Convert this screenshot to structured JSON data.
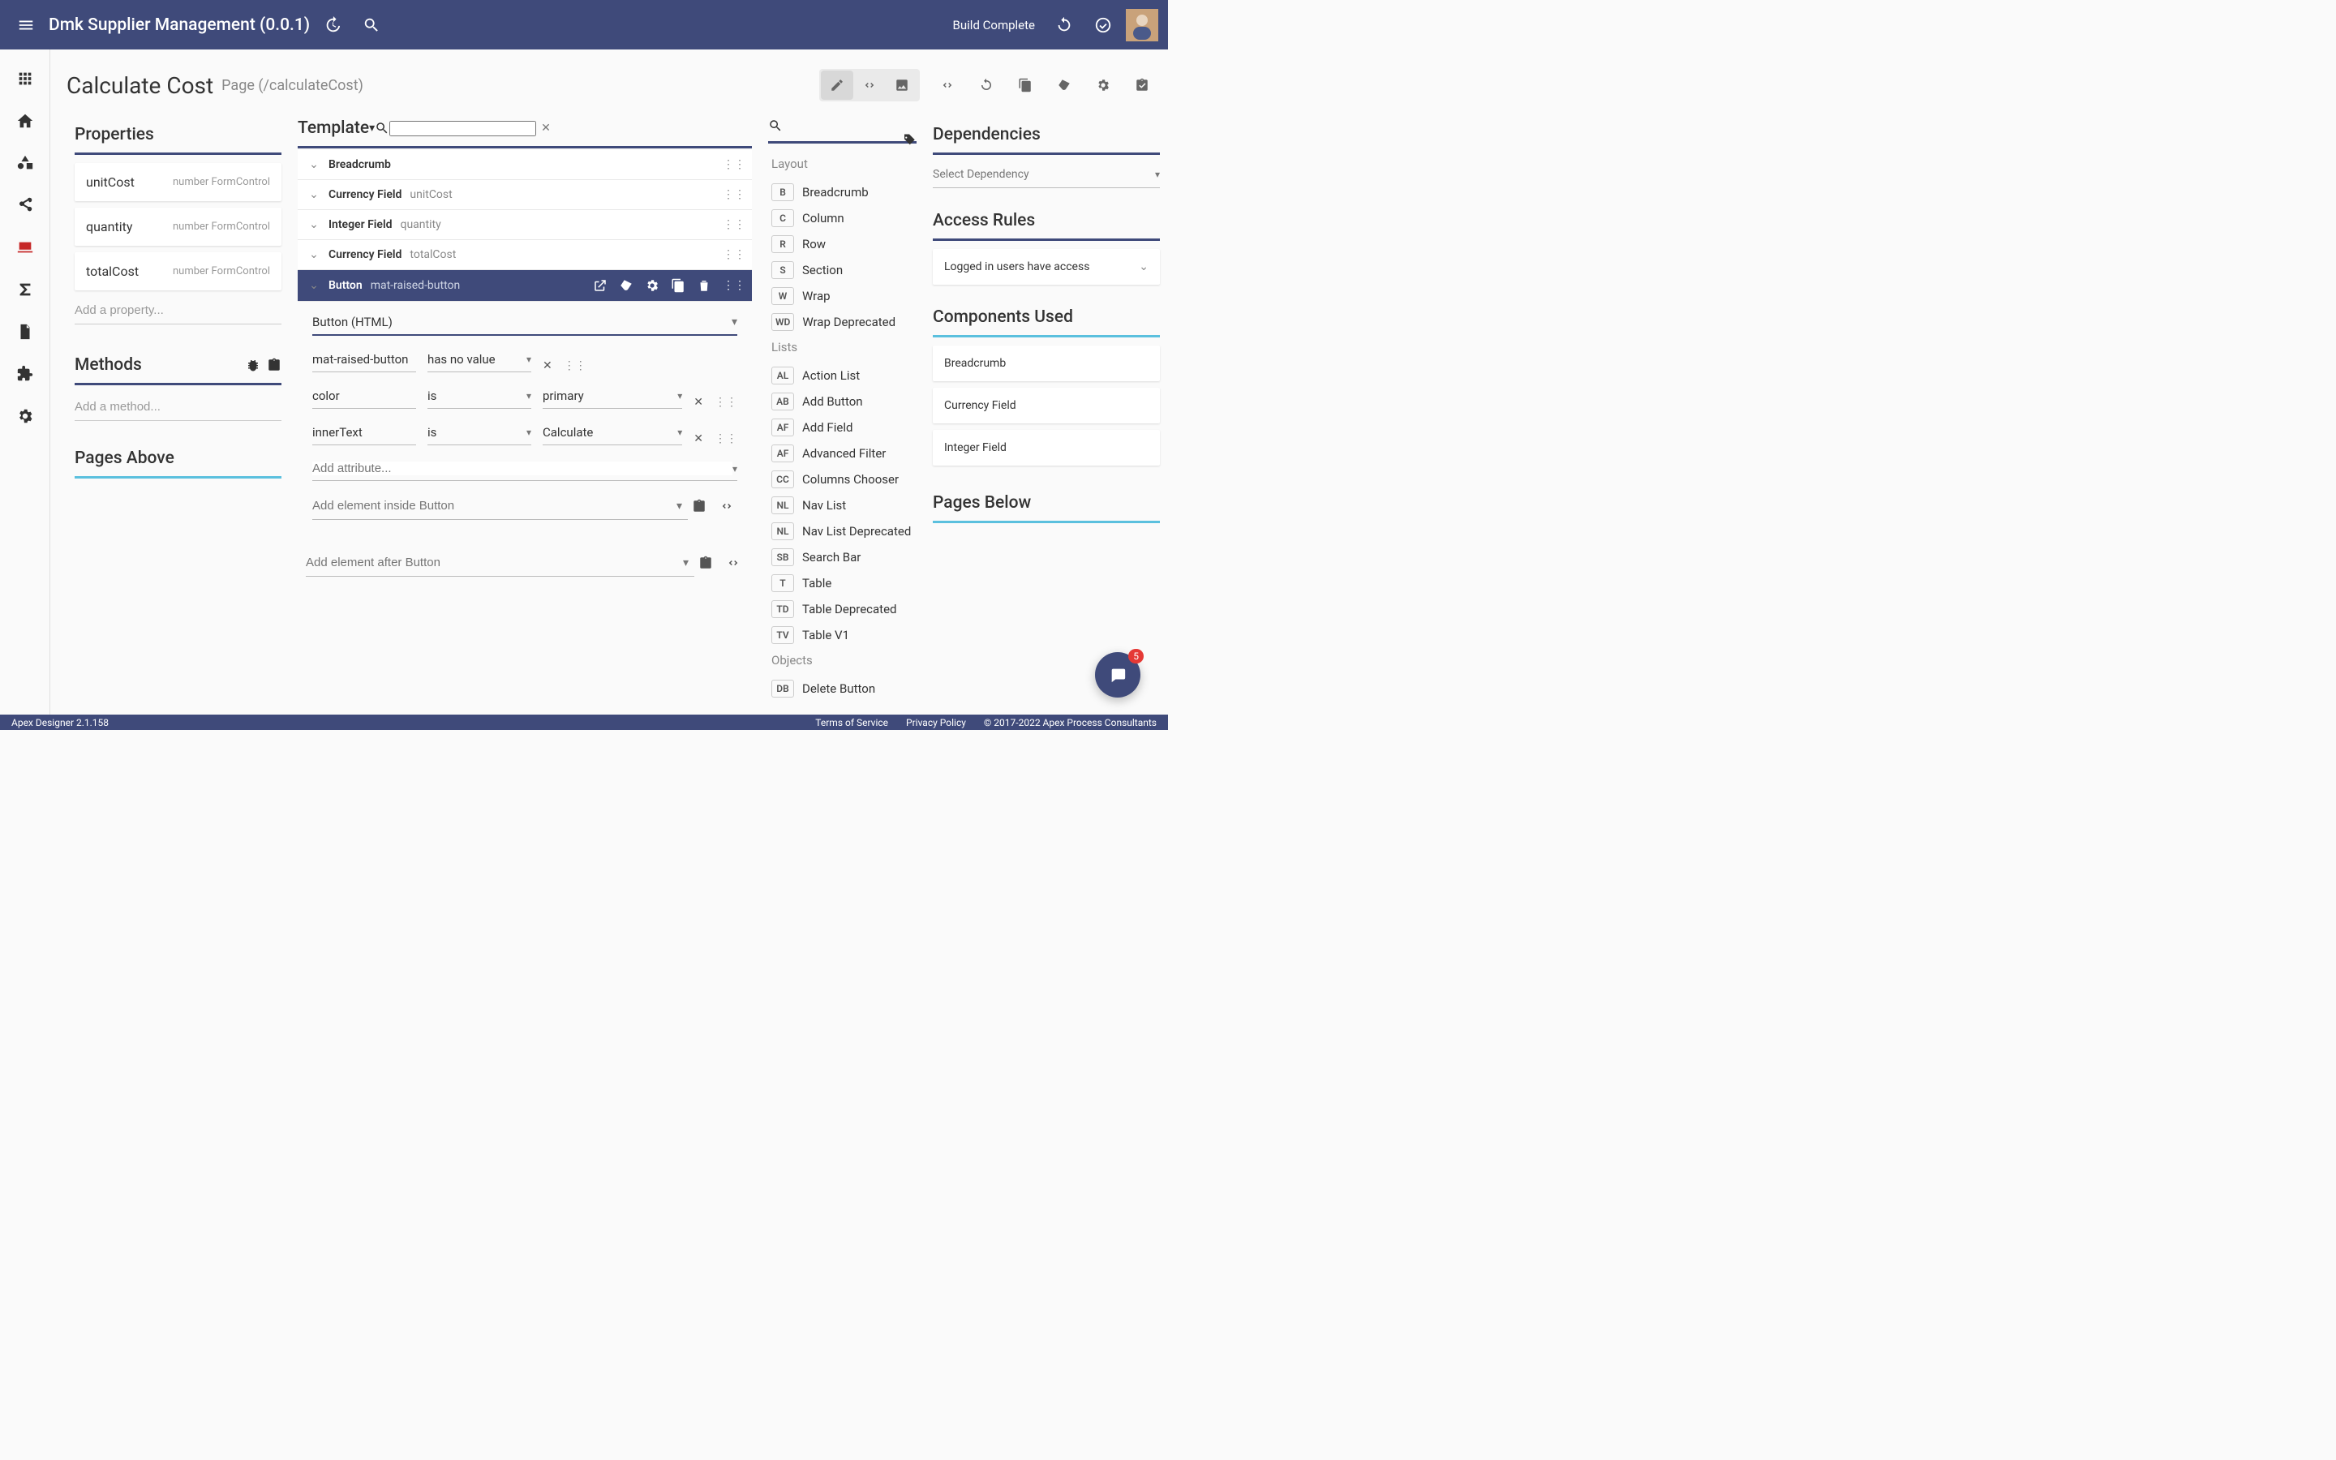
{
  "header": {
    "title": "Dmk Supplier Management (0.0.1)",
    "build_status": "Build Complete"
  },
  "page": {
    "title": "Calculate Cost",
    "path": "Page (/calculateCost)"
  },
  "properties": {
    "title": "Properties",
    "items": [
      {
        "name": "unitCost",
        "type": "number FormControl"
      },
      {
        "name": "quantity",
        "type": "number FormControl"
      },
      {
        "name": "totalCost",
        "type": "number FormControl"
      }
    ],
    "add_placeholder": "Add a property..."
  },
  "methods": {
    "title": "Methods",
    "add_placeholder": "Add a method..."
  },
  "pages_above": {
    "title": "Pages Above"
  },
  "template": {
    "title": "Template",
    "rows": [
      {
        "name": "Breadcrumb",
        "detail": ""
      },
      {
        "name": "Currency Field",
        "detail": "unitCost"
      },
      {
        "name": "Integer Field",
        "detail": "quantity"
      },
      {
        "name": "Currency Field",
        "detail": "totalCost"
      }
    ],
    "selected": {
      "name": "Button",
      "detail": "mat-raised-button"
    },
    "attrs": {
      "element": "Button (HTML)",
      "rows": [
        {
          "key": "mat-raised-button",
          "op": "has no value",
          "val": ""
        },
        {
          "key": "color",
          "op": "is",
          "val": "primary"
        },
        {
          "key": "innerText",
          "op": "is",
          "val": "Calculate"
        }
      ],
      "add_attr_placeholder": "Add attribute...",
      "add_inside_placeholder": "Add element inside Button",
      "add_after_placeholder": "Add element after Button"
    }
  },
  "palette": {
    "groups": [
      {
        "title": "Layout",
        "items": [
          {
            "chip": "B",
            "label": "Breadcrumb"
          },
          {
            "chip": "C",
            "label": "Column"
          },
          {
            "chip": "R",
            "label": "Row"
          },
          {
            "chip": "S",
            "label": "Section"
          },
          {
            "chip": "W",
            "label": "Wrap"
          },
          {
            "chip": "WD",
            "label": "Wrap Deprecated"
          }
        ]
      },
      {
        "title": "Lists",
        "items": [
          {
            "chip": "AL",
            "label": "Action List"
          },
          {
            "chip": "AB",
            "label": "Add Button"
          },
          {
            "chip": "AF",
            "label": "Add Field"
          },
          {
            "chip": "AF",
            "label": "Advanced Filter"
          },
          {
            "chip": "CC",
            "label": "Columns Chooser"
          },
          {
            "chip": "NL",
            "label": "Nav List"
          },
          {
            "chip": "NL",
            "label": "Nav List Deprecated"
          },
          {
            "chip": "SB",
            "label": "Search Bar"
          },
          {
            "chip": "T",
            "label": "Table"
          },
          {
            "chip": "TD",
            "label": "Table Deprecated"
          },
          {
            "chip": "TV",
            "label": "Table V1"
          }
        ]
      },
      {
        "title": "Objects",
        "items": [
          {
            "chip": "DB",
            "label": "Delete Button"
          }
        ]
      }
    ]
  },
  "deps": {
    "title": "Dependencies",
    "select_placeholder": "Select Dependency",
    "access": {
      "title": "Access Rules",
      "rule": "Logged in users have access"
    },
    "components": {
      "title": "Components Used",
      "items": [
        "Breadcrumb",
        "Currency Field",
        "Integer Field"
      ]
    },
    "pages_below": {
      "title": "Pages Below"
    }
  },
  "footer": {
    "version": "Apex Designer 2.1.158",
    "tos": "Terms of Service",
    "privacy": "Privacy Policy",
    "copyright": "© 2017-2022 Apex Process Consultants"
  },
  "chat": {
    "badge": "5"
  }
}
